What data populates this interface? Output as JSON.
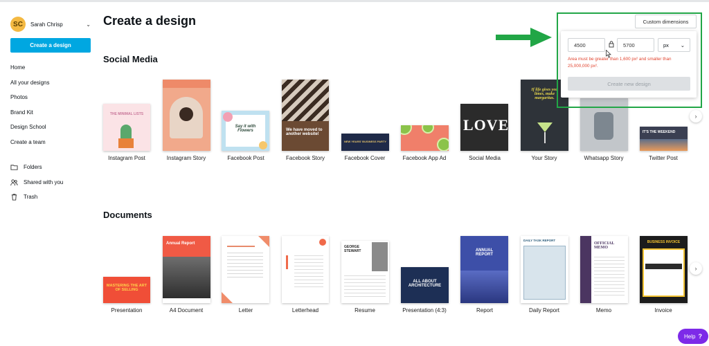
{
  "user": {
    "initials": "SC",
    "name": "Sarah Chrisp"
  },
  "sidebar": {
    "create_label": "Create a design",
    "items": [
      {
        "label": "Home"
      },
      {
        "label": "All your designs"
      },
      {
        "label": "Photos"
      },
      {
        "label": "Brand Kit"
      },
      {
        "label": "Design School"
      },
      {
        "label": "Create a team"
      }
    ],
    "folders": [
      {
        "label": "Folders",
        "icon": "folder-icon"
      },
      {
        "label": "Shared with you",
        "icon": "people-icon"
      },
      {
        "label": "Trash",
        "icon": "trash-icon"
      }
    ]
  },
  "main": {
    "title": "Create a design",
    "social": {
      "title": "Social Media",
      "items": [
        {
          "label": "Instagram Post"
        },
        {
          "label": "Instagram Story"
        },
        {
          "label": "Facebook Post"
        },
        {
          "label": "Facebook Story"
        },
        {
          "label": "Facebook Cover"
        },
        {
          "label": "Facebook App Ad"
        },
        {
          "label": "Social Media"
        },
        {
          "label": "Your Story"
        },
        {
          "label": "Whatsapp Story"
        },
        {
          "label": "Twitter Post"
        }
      ]
    },
    "documents": {
      "title": "Documents",
      "items": [
        {
          "label": "Presentation"
        },
        {
          "label": "A4 Document"
        },
        {
          "label": "Letter"
        },
        {
          "label": "Letterhead"
        },
        {
          "label": "Resume"
        },
        {
          "label": "Presentation (4:3)"
        },
        {
          "label": "Report"
        },
        {
          "label": "Daily Report"
        },
        {
          "label": "Memo"
        },
        {
          "label": "Invoice"
        }
      ]
    }
  },
  "thumb_text": {
    "minimal": "THE MINIMAL LISTS",
    "flowers": "Say it with Flowers",
    "moved": "We have moved to another website!",
    "cover": "NEW YEARS' BUSINESS PARTY",
    "love": "LOVE",
    "margaritas": "If life gives you limes, make margaritas.",
    "weekend": "IT'S THE WEEKEND",
    "selling": "MASTERING THE ART OF SELLING",
    "annual": "Annual Report",
    "george": "GEORGE STEWART",
    "arch": "ALL ABOUT ARCHITECTURE",
    "annual2": "ANNUAL REPORT",
    "daily": "DAILY TASK REPORT",
    "memo": "OFFICIAL MEMO",
    "invoice": "BUSINESS INVOICE"
  },
  "custom": {
    "button_label": "Custom dimensions",
    "width": "4500",
    "height": "5700",
    "unit": "px",
    "error": "Area must be greater than 1,600 px² and smaller than 25,000,000 px².",
    "create_label": "Create new design"
  },
  "help": {
    "label": "Help",
    "mark": "?"
  },
  "colors": {
    "accent": "#00a7e1",
    "highlight": "#21a646",
    "error": "#e1432e",
    "help": "#7d2ae8"
  }
}
